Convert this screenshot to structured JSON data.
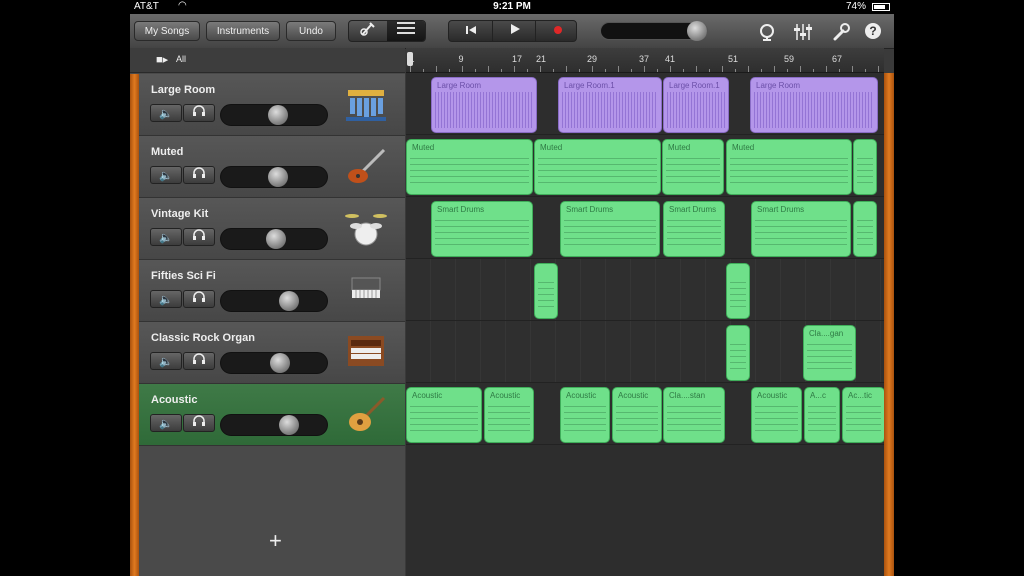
{
  "status_bar": {
    "carrier": "AT&T",
    "time": "9:21 PM",
    "battery": "74%"
  },
  "toolbar": {
    "my_songs": "My Songs",
    "instruments": "Instruments",
    "undo": "Undo"
  },
  "timeline": {
    "all_label": "All",
    "bar_numbers": [
      "1",
      "9",
      "17",
      "21",
      "29",
      "37",
      "41",
      "51",
      "59",
      "67"
    ]
  },
  "tracks": [
    {
      "name": "Large Room",
      "instrument": "xylophone-icon",
      "volume": 0.55
    },
    {
      "name": "Muted",
      "instrument": "electric-guitar-icon",
      "volume": 0.55
    },
    {
      "name": "Vintage Kit",
      "instrument": "drum-kit-icon",
      "volume": 0.52
    },
    {
      "name": "Fifties Sci Fi",
      "instrument": "synth-keyboard-icon",
      "volume": 0.68
    },
    {
      "name": "Classic Rock Organ",
      "instrument": "organ-icon",
      "volume": 0.57
    },
    {
      "name": "Acoustic",
      "instrument": "acoustic-guitar-icon",
      "volume": 0.68,
      "selected": true
    }
  ],
  "regions": {
    "large_room": [
      "Large Room",
      "Large Room.1",
      "Large Room.1",
      "Large Room"
    ],
    "muted": [
      "Muted",
      "Muted",
      "Muted",
      "Muted"
    ],
    "vintage_kit": [
      "Smart Drums",
      "Smart Drums",
      "Smart Drums",
      "Smart Drums"
    ],
    "classic_rock_organ": [
      "Cla....gan"
    ],
    "acoustic": [
      "Acoustic",
      "Acoustic",
      "Acoustic",
      "Acoustic",
      "Cla....stan",
      "Acoustic",
      "A...c",
      "Ac...tic"
    ]
  },
  "add_track_label": "+",
  "colors": {
    "audio_region": "#b496ea",
    "midi_region": "#6fe08a",
    "accent": "#e07a20",
    "selected_track": "#3f7a47"
  }
}
